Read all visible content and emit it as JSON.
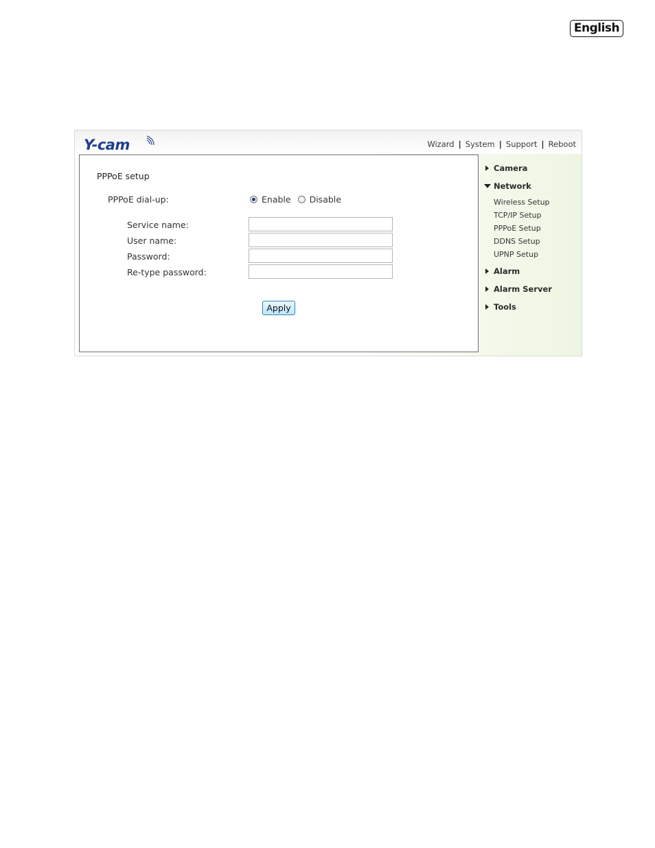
{
  "language_badge": "English",
  "header": {
    "logo_text": "Y-cam",
    "nav": [
      "Wizard",
      "System",
      "Support",
      "Reboot"
    ]
  },
  "form": {
    "title": "PPPoE setup",
    "dialup_label": "PPPoE dial-up:",
    "enable_label": "Enable",
    "disable_label": "Disable",
    "selected": "Enable",
    "fields": [
      {
        "label": "Service name:",
        "value": ""
      },
      {
        "label": "User name:",
        "value": ""
      },
      {
        "label": "Password:",
        "value": ""
      },
      {
        "label": "Re-type password:",
        "value": ""
      }
    ],
    "apply_label": "Apply"
  },
  "sidebar": {
    "items": [
      {
        "label": "Camera",
        "expanded": false
      },
      {
        "label": "Network",
        "expanded": true,
        "children": [
          "Wireless Setup",
          "TCP/IP Setup",
          "PPPoE Setup",
          "DDNS Setup",
          "UPNP Setup"
        ]
      },
      {
        "label": "Alarm",
        "expanded": false
      },
      {
        "label": "Alarm Server",
        "expanded": false
      },
      {
        "label": "Tools",
        "expanded": false
      }
    ]
  },
  "colors": {
    "logo_blue": "#1e3f8c",
    "button_border": "#3c7fb1",
    "sidebar_tint": "#eef6e2"
  }
}
